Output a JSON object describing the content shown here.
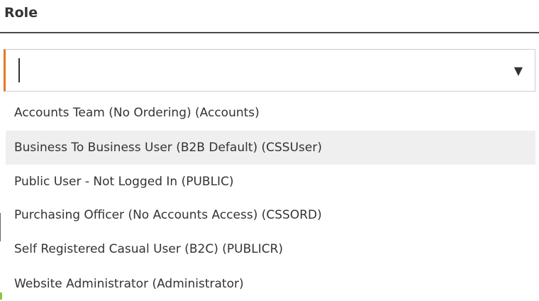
{
  "field": {
    "label": "Role",
    "value": "",
    "accent_color": "#e87722"
  },
  "dropdown": {
    "arrow_icon": "triangle-down",
    "options": [
      {
        "label": "Accounts Team (No Ordering) (Accounts)",
        "highlighted": false
      },
      {
        "label": "Business To Business User (B2B Default) (CSSUser)",
        "highlighted": true
      },
      {
        "label": "Public User - Not Logged In (PUBLIC)",
        "highlighted": false
      },
      {
        "label": "Purchasing Officer (No Accounts Access) (CSSORD)",
        "highlighted": false
      },
      {
        "label": "Self Registered Casual User (B2C) (PUBLICR)",
        "highlighted": false
      },
      {
        "label": "Website Administrator (Administrator)",
        "highlighted": false
      }
    ]
  }
}
